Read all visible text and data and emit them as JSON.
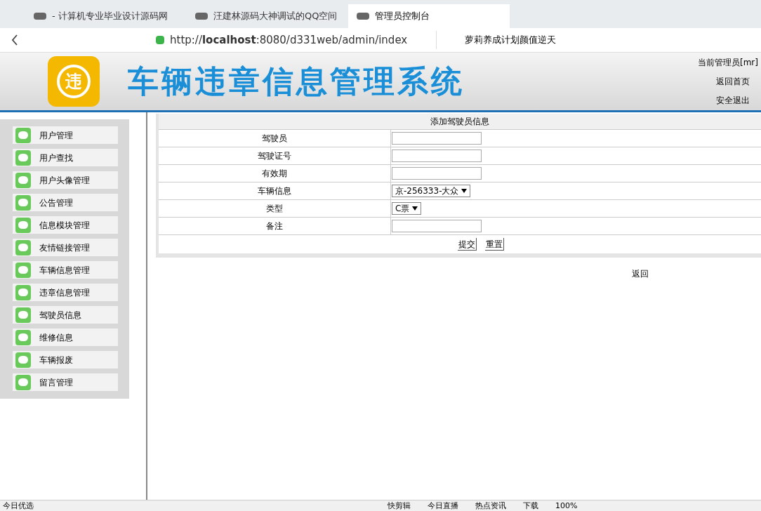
{
  "browser": {
    "tabs": [
      {
        "label": "- 计算机专业毕业设计源码网",
        "selected": false
      },
      {
        "label": "汪建林源码大神调试的QQ空间",
        "selected": false
      },
      {
        "label": "管理员控制台",
        "selected": true
      }
    ],
    "address": {
      "prefix": "http://",
      "host": "localhost",
      "rest": ":8080/d331web/admin/index"
    },
    "search": "萝莉养成计划颜值逆天"
  },
  "header": {
    "title": "车辆违章信息管理系统",
    "logo": "违",
    "links": [
      "当前管理员[mr]",
      "返回首页",
      "安全退出"
    ]
  },
  "sidebar": {
    "items": [
      "用户管理",
      "用户查找",
      "用户头像管理",
      "公告管理",
      "信息模块管理",
      "友情链接管理",
      "车辆信息管理",
      "违章信息管理",
      "驾驶员信息",
      "维修信息",
      "车辆报废",
      "留言管理"
    ]
  },
  "form": {
    "title": "添加驾驶员信息",
    "fields": [
      {
        "label": "驾驶员",
        "kind": "text"
      },
      {
        "label": "驾驶证号",
        "kind": "text"
      },
      {
        "label": "有效期",
        "kind": "text"
      },
      {
        "label": "车辆信息",
        "kind": "select",
        "value": "京-256333-大众"
      },
      {
        "label": "类型",
        "kind": "select",
        "value": "C票"
      },
      {
        "label": "备注",
        "kind": "text"
      }
    ],
    "buttons": [
      "提交",
      "重置"
    ],
    "back": "返回"
  },
  "status_bar": {
    "items": [
      "今日优选",
      "快剪辑",
      "今日直播",
      "热点资讯",
      "下载",
      "100%"
    ]
  }
}
